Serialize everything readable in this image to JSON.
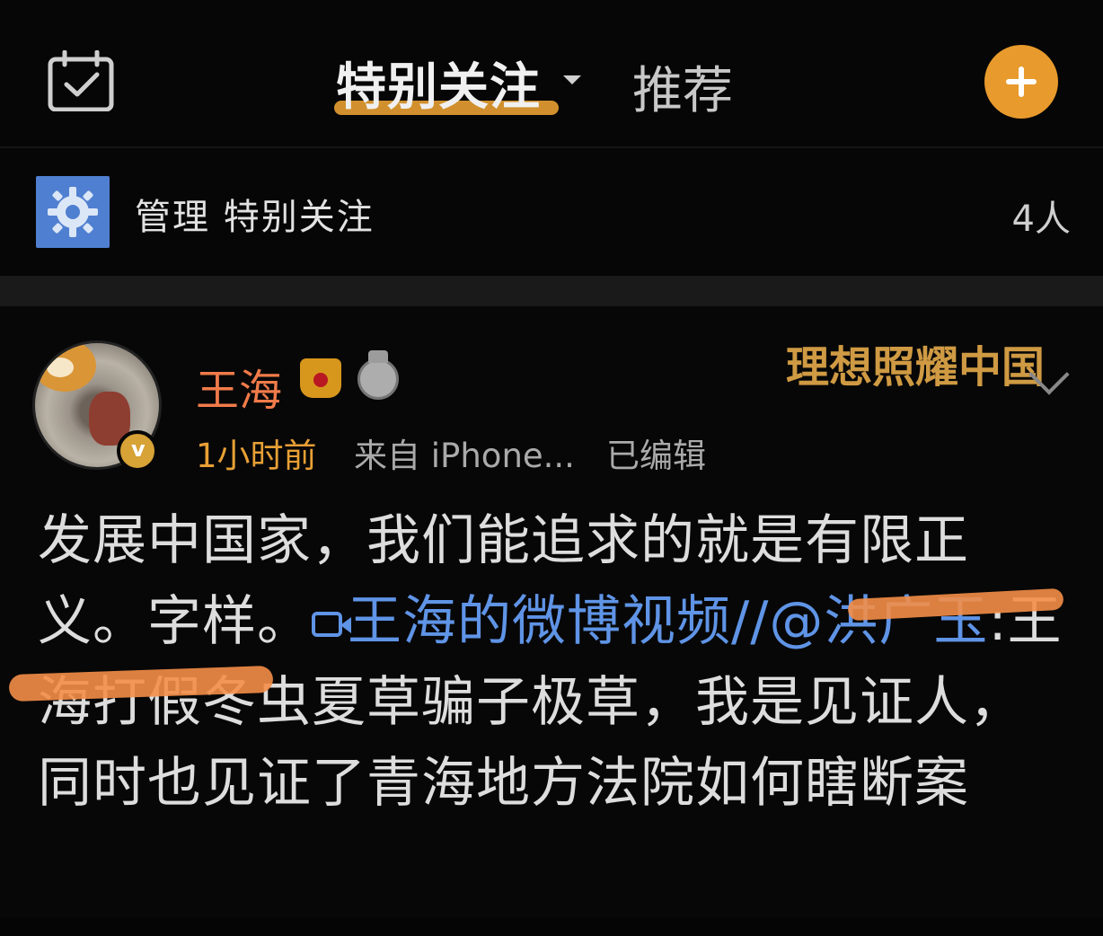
{
  "topbar": {
    "tab_special": "特别关注",
    "tab_recommend": "推荐"
  },
  "manage": {
    "label": "管理 特别关注",
    "count": "4人"
  },
  "post": {
    "author": "王海",
    "topic": "理想照耀中国",
    "time": "1小时前",
    "source": "来自 iPhone...",
    "edited": "已编辑",
    "text_part1": "发展中国家，我们能追求的就是有限正义。字样。",
    "video_link": "王海的微博视频",
    "repost_mention": "//@洪广玉",
    "text_part2": ":王海打假冬虫夏草骗子极草，我是见证人，同时也见证了青海地方法院如何瞎断案"
  },
  "colors": {
    "accent_orange": "#e89a2c",
    "author_orange": "#f07b4a",
    "link_blue": "#5f94e6",
    "topic_gold": "#cf9a43"
  },
  "icons": {
    "calendar": "calendar-check-icon",
    "add": "plus-circle-icon",
    "gear": "gear-icon",
    "verified": "verified-badge-icon",
    "crown": "crown-icon",
    "medal": "medal-icon",
    "chevron": "chevron-down-icon",
    "video": "video-icon"
  }
}
